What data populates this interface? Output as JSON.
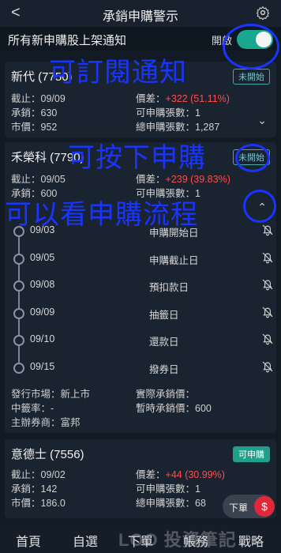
{
  "header": {
    "back": "<",
    "title": "承銷申購警示"
  },
  "notify": {
    "label": "所有新申購股上架通知",
    "state": "開啟"
  },
  "cards": [
    {
      "name": "新代 (7750)",
      "badge": "未開始",
      "f1l": "截止：09/09",
      "f1r_label": "價差：",
      "f1r_value": "+322 (51.11%)",
      "f2l": "承銷：630",
      "f2r": "可申購張數：1",
      "f3l": "市價：952",
      "f3r": "總申購張數：1,287",
      "chev": "⌄"
    },
    {
      "name": "禾榮科 (7790)",
      "badge": "未開始",
      "f1l": "截止：09/05",
      "f1r_label": "價差：",
      "f1r_value": "+239 (39.83%)",
      "f2l": "承銷：600",
      "f2r": "可申購張數：1",
      "f3l": "",
      "f3r": "",
      "chev": "⌃",
      "timeline": [
        {
          "date": "09/03",
          "event": "申購開始日"
        },
        {
          "date": "09/05",
          "event": "申購截止日"
        },
        {
          "date": "09/08",
          "event": "預扣款日"
        },
        {
          "date": "09/09",
          "event": "抽籤日"
        },
        {
          "date": "09/10",
          "event": "還款日"
        },
        {
          "date": "09/15",
          "event": "撥券日"
        }
      ],
      "info": {
        "market": "發行市場：新上市",
        "actual": "實際承銷價：",
        "rate": "中籤率：-",
        "temp": "暫時承銷價：600",
        "broker": "主辦券商：富邦"
      }
    },
    {
      "name": "意德士 (7556)",
      "badge": "可申購",
      "f1l": "截止：09/02",
      "f1r_label": "價差：",
      "f1r_value": "+44 (30.99%)",
      "f2l": "承銷：142",
      "f2r": "可申購張數：1",
      "f3l": "市價：186.0",
      "f3r": "總申購張數：68"
    }
  ],
  "overlays": {
    "o1": "可訂閱通知",
    "o2": "可按下申購",
    "o3": "可以看申購流程"
  },
  "tabs": [
    "首頁",
    "自選",
    "下單",
    "帳務",
    "戰略"
  ],
  "order": {
    "label": "下單",
    "icon": "$"
  },
  "watermark": "LOO 投資筆記"
}
